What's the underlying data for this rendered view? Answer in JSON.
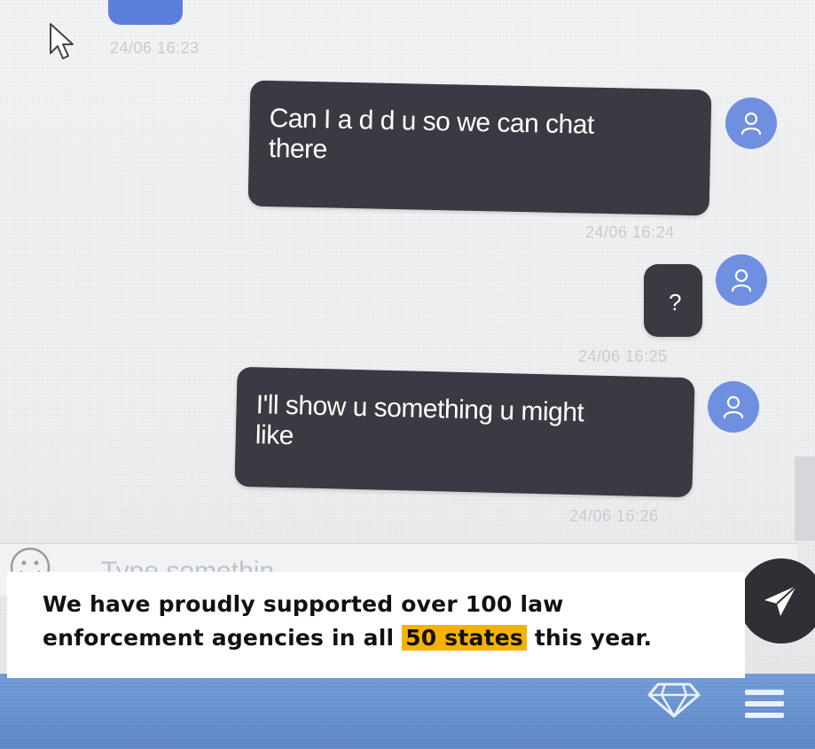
{
  "chat": {
    "top_timestamp": "24/06 16:23",
    "messages": [
      {
        "text": "Can I a d d u so we can chat there",
        "line1": "Can I a d d u so we can chat",
        "line2": "there",
        "timestamp": "24/06 16:24"
      },
      {
        "text": "?",
        "timestamp": "24/06 16:25"
      },
      {
        "text": "I'll show u something u might like",
        "line1": "I'll show u something u might",
        "line2": "like",
        "timestamp": "24/06 16:26"
      }
    ]
  },
  "input": {
    "placeholder": "Type somethin"
  },
  "caption": {
    "line1": "We have proudly supported over 100 law",
    "line2_before": "enforcement agencies in all ",
    "line2_highlight": "50 states",
    "line2_after": " this year."
  },
  "colors": {
    "bubble": "#3a3a42",
    "avatar": "#6f8fe0",
    "highlight": "#f5b301",
    "footer": "#5d86c6"
  },
  "icons": [
    "cursor-icon",
    "user-icon",
    "emoji-icon",
    "send-icon",
    "diamond-icon",
    "menu-icon"
  ]
}
